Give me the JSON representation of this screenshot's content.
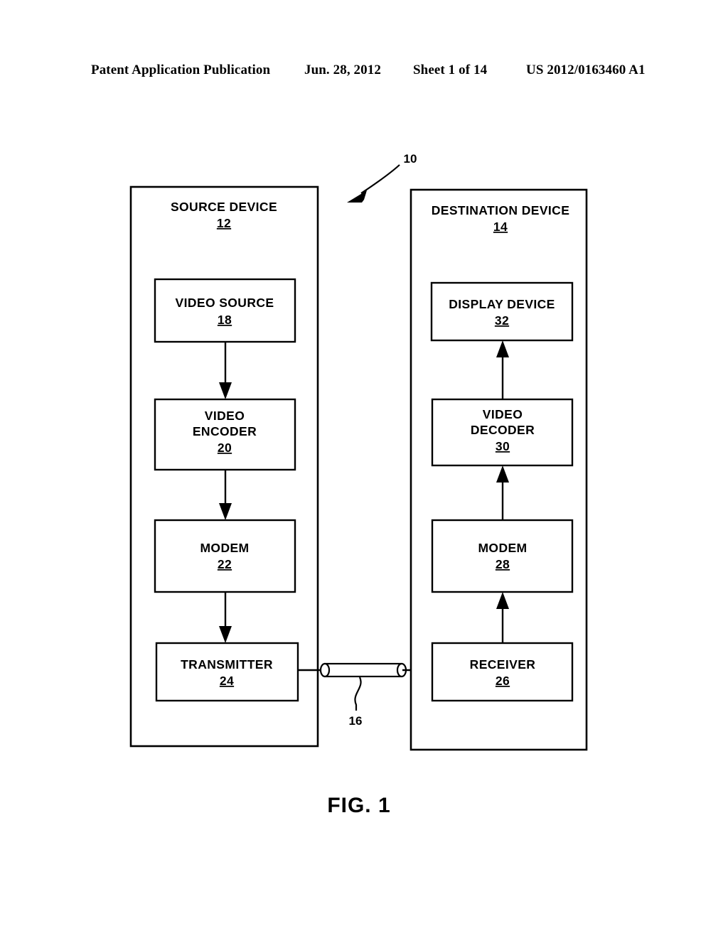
{
  "header": {
    "publication": "Patent Application Publication",
    "date": "Jun. 28, 2012",
    "sheet": "Sheet 1 of 14",
    "publication_number": "US 2012/0163460 A1"
  },
  "figure": {
    "caption": "FIG. 1",
    "system_reference": "10",
    "channel_reference": "16",
    "source_device": {
      "title": "SOURCE DEVICE",
      "reference": "12",
      "blocks": [
        {
          "label_line1": "VIDEO SOURCE",
          "label_line2": "",
          "reference": "18"
        },
        {
          "label_line1": "VIDEO",
          "label_line2": "ENCODER",
          "reference": "20"
        },
        {
          "label_line1": "MODEM",
          "label_line2": "",
          "reference": "22"
        },
        {
          "label_line1": "TRANSMITTER",
          "label_line2": "",
          "reference": "24"
        }
      ]
    },
    "destination_device": {
      "title": "DESTINATION DEVICE",
      "reference": "14",
      "blocks": [
        {
          "label_line1": "DISPLAY DEVICE",
          "label_line2": "",
          "reference": "32"
        },
        {
          "label_line1": "VIDEO",
          "label_line2": "DECODER",
          "reference": "30"
        },
        {
          "label_line1": "MODEM",
          "label_line2": "",
          "reference": "28"
        },
        {
          "label_line1": "RECEIVER",
          "label_line2": "",
          "reference": "26"
        }
      ]
    }
  },
  "colors": {
    "ink": "#000000",
    "paper": "#ffffff"
  }
}
